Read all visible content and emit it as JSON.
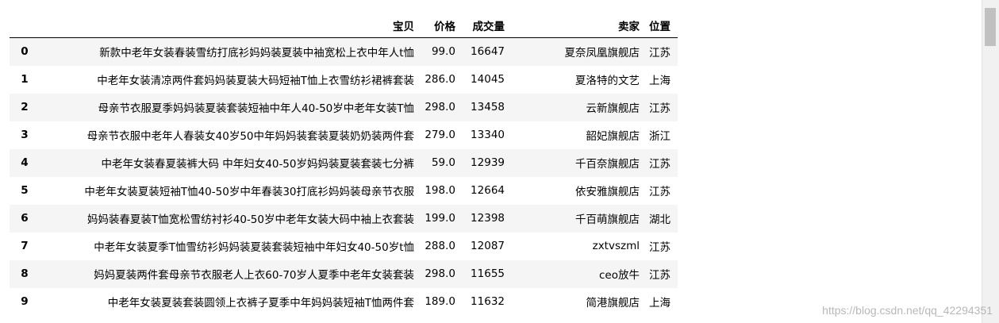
{
  "table": {
    "columns": [
      "",
      "宝贝",
      "价格",
      "成交量",
      "卖家",
      "位置"
    ],
    "rows": [
      {
        "index": "0",
        "name": "新款中老年女装春装雪纺打底衫妈妈装夏装中袖宽松上衣中年人t恤",
        "price": "99.0",
        "volume": "16647",
        "seller": "夏奈凤凰旗舰店",
        "location": "江苏"
      },
      {
        "index": "1",
        "name": "中老年女装清凉两件套妈妈装夏装大码短袖T恤上衣雪纺衫裙裤套装",
        "price": "286.0",
        "volume": "14045",
        "seller": "夏洛特的文艺",
        "location": "上海"
      },
      {
        "index": "2",
        "name": "母亲节衣服夏季妈妈装夏装套装短袖中年人40-50岁中老年女装T恤",
        "price": "298.0",
        "volume": "13458",
        "seller": "云新旗舰店",
        "location": "江苏"
      },
      {
        "index": "3",
        "name": "母亲节衣服中老年人春装女40岁50中年妈妈装套装夏装奶奶装两件套",
        "price": "279.0",
        "volume": "13340",
        "seller": "韶妃旗舰店",
        "location": "浙江"
      },
      {
        "index": "4",
        "name": "中老年女装春夏装裤大码 中年妇女40-50岁妈妈装夏装套装七分裤",
        "price": "59.0",
        "volume": "12939",
        "seller": "千百奈旗舰店",
        "location": "江苏"
      },
      {
        "index": "5",
        "name": "中老年女装夏装短袖T恤40-50岁中年春装30打底衫妈妈装母亲节衣服",
        "price": "198.0",
        "volume": "12664",
        "seller": "依安雅旗舰店",
        "location": "江苏"
      },
      {
        "index": "6",
        "name": "妈妈装春夏装T恤宽松雪纺衬衫40-50岁中老年女装大码中袖上衣套装",
        "price": "199.0",
        "volume": "12398",
        "seller": "千百萌旗舰店",
        "location": "湖北"
      },
      {
        "index": "7",
        "name": "中老年女装夏季T恤雪纺衫妈妈装夏装套装短袖中年妇女40-50岁t恤",
        "price": "288.0",
        "volume": "12087",
        "seller": "zxtvszml",
        "location": "江苏"
      },
      {
        "index": "8",
        "name": "妈妈夏装两件套母亲节衣服老人上衣60-70岁人夏季中老年女装套装",
        "price": "298.0",
        "volume": "11655",
        "seller": "ceo放牛",
        "location": "江苏"
      },
      {
        "index": "9",
        "name": "中老年女装夏装套装圆领上衣裤子夏季中年妈妈装短袖T恤两件套",
        "price": "189.0",
        "volume": "11632",
        "seller": "简港旗舰店",
        "location": "上海"
      }
    ]
  },
  "watermark": "https://blog.csdn.net/qq_42294351",
  "colors": {
    "stripe": "#f5f5f5",
    "header_rule": "#000000",
    "scrollbar_track": "#f1f1f1",
    "scrollbar_thumb": "#c1c1c1"
  }
}
